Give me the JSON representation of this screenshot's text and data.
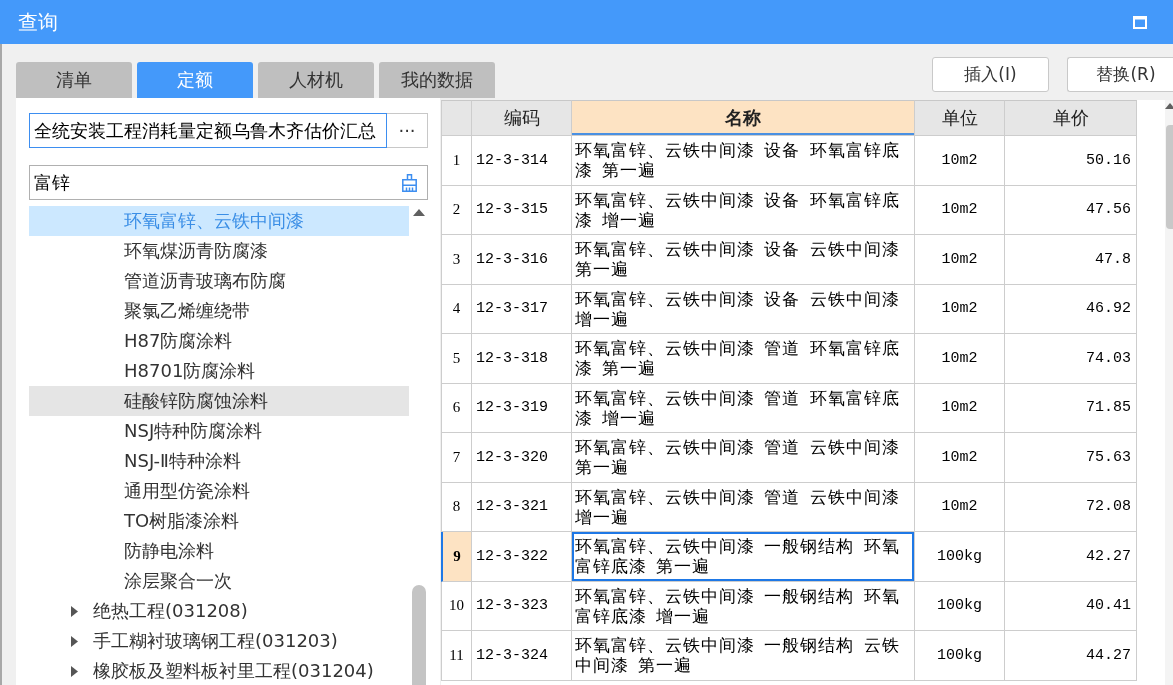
{
  "window": {
    "title": "查询"
  },
  "tabs": [
    {
      "label": "清单",
      "selected": false
    },
    {
      "label": "定额",
      "selected": true
    },
    {
      "label": "人材机",
      "selected": false
    },
    {
      "label": "我的数据",
      "selected": false
    }
  ],
  "actions": [
    {
      "label": "插入(I)"
    },
    {
      "label": "替换(R)"
    }
  ],
  "library": {
    "value": "全统安装工程消耗量定额乌鲁木齐估价汇总",
    "browse_button": "···"
  },
  "search": {
    "value": "富锌"
  },
  "tree": [
    {
      "children": [
        {
          "label": "环氧富锌、云铁中间漆",
          "selected": true,
          "hovered": false
        },
        {
          "label": "环氧煤沥青防腐漆",
          "selected": false,
          "hovered": false
        },
        {
          "label": "管道沥青玻璃布防腐",
          "selected": false,
          "hovered": false
        },
        {
          "label": "聚氯乙烯缠绕带",
          "selected": false,
          "hovered": false
        },
        {
          "label": "H87防腐涂料",
          "selected": false,
          "hovered": false
        },
        {
          "label": "H8701防腐涂料",
          "selected": false,
          "hovered": false
        },
        {
          "label": "硅酸锌防腐蚀涂料",
          "selected": false,
          "hovered": true
        },
        {
          "label": "NSJ特种防腐涂料",
          "selected": false,
          "hovered": false
        },
        {
          "label": "NSJ-Ⅱ特种涂料",
          "selected": false,
          "hovered": false
        },
        {
          "label": "通用型仿瓷涂料",
          "selected": false,
          "hovered": false
        },
        {
          "label": "TO树脂漆涂料",
          "selected": false,
          "hovered": false
        },
        {
          "label": "防静电涂料",
          "selected": false,
          "hovered": false
        },
        {
          "label": "涂层聚合一次",
          "selected": false,
          "hovered": false
        }
      ]
    },
    {
      "label": "绝热工程(031208)",
      "expanded": false,
      "selected": false,
      "hovered": false
    },
    {
      "label": "手工糊衬玻璃钢工程(031203)",
      "expanded": false,
      "selected": false,
      "hovered": false
    },
    {
      "label": "橡胶板及塑料板衬里工程(031204)",
      "expanded": false,
      "selected": false,
      "hovered": false
    }
  ],
  "table": {
    "columns": [
      {
        "label": "编码",
        "selected": false
      },
      {
        "label": "名称",
        "selected": true
      },
      {
        "label": "单位",
        "selected": false
      },
      {
        "label": "单价",
        "selected": false
      }
    ],
    "rows": [
      {
        "number": "1",
        "code": "12-3-314",
        "name": "环氧富锌、云铁中间漆 设备 环氧富锌底漆 第一遍",
        "unit": "10m2",
        "price": "50.16",
        "selected": false
      },
      {
        "number": "2",
        "code": "12-3-315",
        "name": "环氧富锌、云铁中间漆 设备 环氧富锌底漆 增一遍",
        "unit": "10m2",
        "price": "47.56",
        "selected": false
      },
      {
        "number": "3",
        "code": "12-3-316",
        "name": "环氧富锌、云铁中间漆 设备 云铁中间漆第一遍",
        "unit": "10m2",
        "price": "47.8",
        "selected": false
      },
      {
        "number": "4",
        "code": "12-3-317",
        "name": "环氧富锌、云铁中间漆 设备 云铁中间漆增一遍",
        "unit": "10m2",
        "price": "46.92",
        "selected": false
      },
      {
        "number": "5",
        "code": "12-3-318",
        "name": "环氧富锌、云铁中间漆 管道 环氧富锌底漆 第一遍",
        "unit": "10m2",
        "price": "74.03",
        "selected": false
      },
      {
        "number": "6",
        "code": "12-3-319",
        "name": "环氧富锌、云铁中间漆 管道 环氧富锌底漆 增一遍",
        "unit": "10m2",
        "price": "71.85",
        "selected": false
      },
      {
        "number": "7",
        "code": "12-3-320",
        "name": "环氧富锌、云铁中间漆 管道 云铁中间漆第一遍",
        "unit": "10m2",
        "price": "75.63",
        "selected": false
      },
      {
        "number": "8",
        "code": "12-3-321",
        "name": "环氧富锌、云铁中间漆 管道 云铁中间漆增一遍",
        "unit": "10m2",
        "price": "72.08",
        "selected": false
      },
      {
        "number": "9",
        "code": "12-3-322",
        "name": "环氧富锌、云铁中间漆 一般钢结构 环氧富锌底漆 第一遍",
        "unit": "100kg",
        "price": "42.27",
        "selected": true
      },
      {
        "number": "10",
        "code": "12-3-323",
        "name": "环氧富锌、云铁中间漆 一般钢结构 环氧富锌底漆 增一遍",
        "unit": "100kg",
        "price": "40.41",
        "selected": false
      },
      {
        "number": "11",
        "code": "12-3-324",
        "name": "环氧富锌、云铁中间漆 一般钢结构 云铁中间漆 第一遍",
        "unit": "100kg",
        "price": "44.27",
        "selected": false
      }
    ]
  }
}
